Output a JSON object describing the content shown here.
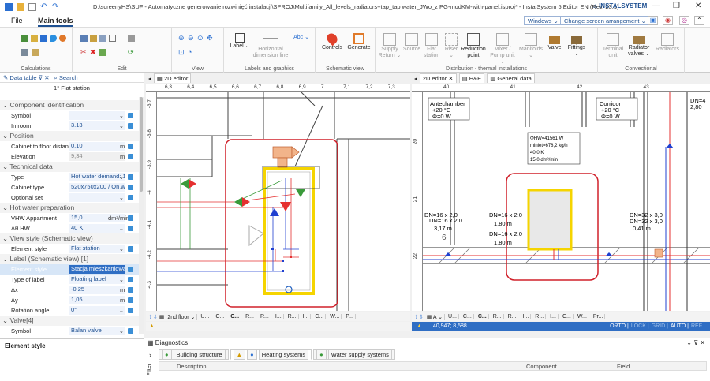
{
  "window": {
    "title": "D:\\screenyHS\\SUF - Automatyczne generowanie rozwinięć instalacji\\SPROJ\\Multifamily_All_levels_radiators+tap_tap water_JWo_z PG-modKM-with-panel.isproj* - InstalSystem 5 Editor EN (Rev. 23.1)",
    "brand": "INSTALSYSTEM"
  },
  "menu": {
    "file": "File",
    "main_tools": "Main tools",
    "windows_dd": "Windows",
    "screen_arrangement_dd": "Change screen arrangement"
  },
  "ribbon": {
    "groups": {
      "calculations": "Calculations",
      "edit": "Edit",
      "view": "View",
      "labels_graphics": "Labels and graphics",
      "schematic_view": "Schematic view",
      "distribution": "Distribution - thermal installations",
      "convectional": "Convectional"
    },
    "buttons": {
      "label": "Label",
      "horizontal_dimension_line": "Horizontal dimension line",
      "abc": "Abc",
      "controls": "Controls",
      "generate": "Generate",
      "supply_return": "Supply Return",
      "source": "Source",
      "flat_station": "Flat station",
      "riser": "Riser",
      "reduction_point": "Reduction point",
      "mixer_pump_unit": "Mixer / Pump unit",
      "manifolds": "Manifolds",
      "valve": "Valve",
      "fittings": "Fittings",
      "terminal_unit": "Terminal unit",
      "radiator_valves": "Radiator valves",
      "radiators": "Radiators"
    }
  },
  "left_panel": {
    "tab_data_table": "Data table",
    "tab_search": "Search",
    "object_title": "1° Flat station",
    "sections": {
      "component_identification": "Component identification",
      "position": "Position",
      "technical_data": "Technical data",
      "hot_water_preparation": "Hot water preparation",
      "view_style": "View style (Schematic view)",
      "label": "Label (Schematic view) [1]",
      "valve": "Valve[4]"
    },
    "rows": {
      "symbol": {
        "label": "Symbol",
        "value": ""
      },
      "in_room": {
        "label": "In room",
        "value": "3.13"
      },
      "cabinet_floor_distance": {
        "label": "Cabinet to floor distanc",
        "value": "0,10",
        "unit": "m"
      },
      "elevation": {
        "label": "Elevation",
        "value": "9,34",
        "unit": "m"
      },
      "type": {
        "label": "Type",
        "value": "Hot water demand: 1"
      },
      "cabinet_type": {
        "label": "Cabinet type",
        "value": "520x750x200 / On wa"
      },
      "optional_set": {
        "label": "Optional set",
        "value": ""
      },
      "v_hw_appartment": {
        "label": "V̇HW Appartment",
        "value": "15,0",
        "unit": "dm³/min"
      },
      "delta_theta_hw": {
        "label": "Δθ HW",
        "value": "40 K"
      },
      "element_style_view": {
        "label": "Element style",
        "value": "Flat station"
      },
      "element_style_label": {
        "label": "Element style",
        "value": "Stacja mieszkaniowa"
      },
      "type_of_label": {
        "label": "Type of label",
        "value": "Floating label"
      },
      "dx": {
        "label": "Δx",
        "value": "-0,25",
        "unit": "m"
      },
      "dy": {
        "label": "Δy",
        "value": "1,05",
        "unit": "m"
      },
      "rotation_angle": {
        "label": "Rotation angle",
        "value": "0°"
      },
      "valve_symbol": {
        "label": "Symbol",
        "value": "Balan valve"
      }
    },
    "footer_title": "Element style"
  },
  "editor_left": {
    "tab": "2D editor",
    "ruler_top": [
      "6,3",
      "6,4",
      "6,5",
      "6,6",
      "6,7",
      "6,8",
      "6,9",
      "7",
      "7,1",
      "7,2",
      "7,3"
    ],
    "ruler_side": [
      "-3,7",
      "-3,8",
      "-3,9",
      "-4",
      "-4,1",
      "-4,2",
      "-4,3"
    ],
    "floor_selector": "2nd floor",
    "footer_tabs": [
      "U...",
      "C...",
      "C...",
      "R...",
      "R...",
      "I...",
      "R...",
      "I...",
      "C...",
      "W...",
      "P..."
    ]
  },
  "editor_right": {
    "tab": "2D editor",
    "tab_he": "H&E",
    "tab_general": "General data",
    "ruler_top": [
      "40",
      "41",
      "42",
      "43"
    ],
    "ruler_side": [
      "20",
      "21",
      "22"
    ],
    "room_antechamber": {
      "name": "Antechamber",
      "temp": "+20 °C",
      "phi": "Φ=0 W"
    },
    "room_corridor": {
      "name": "Corridor",
      "temp": "+20 °C",
      "phi": "Φ=0 W"
    },
    "station_info": [
      "ΦHW=41561 W",
      "ṁinlet=678,2 kg/h",
      "40,0 K",
      "15,0 dm³/min"
    ],
    "pipe_labels": [
      "DN=16 x 2,0",
      "DN=16 x 2,0",
      "3,17 m",
      "DN=16 x 2,0",
      "1,80 m",
      "DN=16 x 2,0",
      "1,80 m",
      "DN=32 x 3,0",
      "DN=32 x 3,0",
      "0,41 m",
      "DN=4",
      "2,80"
    ],
    "number_label": "6",
    "floor_selector": "A",
    "footer_tabs": [
      "U...",
      "C...",
      "C...",
      "R...",
      "R...",
      "I...",
      "R...",
      "I...",
      "C...",
      "W...",
      "Pr..."
    ],
    "coords": "40,947; 8,588",
    "snaps": [
      "ORTO",
      "LOCK",
      "GRID",
      "AUTO",
      "REF"
    ]
  },
  "diagnostics": {
    "title": "Diagnostics",
    "tabs": [
      "Building structure",
      "Heating systems",
      "Water supply systems"
    ],
    "columns": [
      "Description",
      "Component",
      "Field"
    ],
    "filter": "Filter"
  },
  "colors": {
    "accent": "#1d4f91",
    "station_red": "#d0202a",
    "station_yellow": "#f5d400",
    "supply_red": "#e53030",
    "return_blue": "#2040d0"
  }
}
